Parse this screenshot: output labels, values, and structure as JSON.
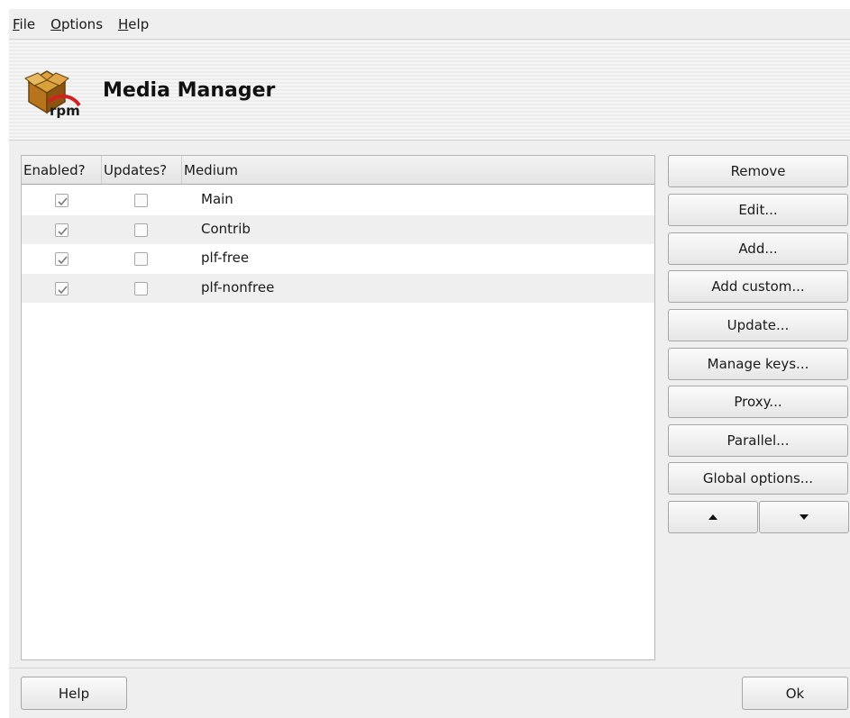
{
  "menubar": {
    "items": [
      {
        "mnemonic": "F",
        "rest": "ile"
      },
      {
        "mnemonic": "O",
        "rest": "ptions"
      },
      {
        "mnemonic": "H",
        "rest": "elp"
      }
    ]
  },
  "header": {
    "title": "Media Manager",
    "logo_text": "rpm",
    "logo_icon": "rpm-package-icon"
  },
  "list": {
    "columns": {
      "enabled": "Enabled?",
      "updates": "Updates?",
      "medium": "Medium"
    },
    "rows": [
      {
        "enabled": true,
        "updates": false,
        "medium": "Main"
      },
      {
        "enabled": true,
        "updates": false,
        "medium": "Contrib"
      },
      {
        "enabled": true,
        "updates": false,
        "medium": "plf-free"
      },
      {
        "enabled": true,
        "updates": false,
        "medium": "plf-nonfree"
      }
    ]
  },
  "buttons": {
    "remove": "Remove",
    "edit": "Edit...",
    "add": "Add...",
    "add_custom": "Add custom...",
    "update": "Update...",
    "manage_keys": "Manage keys...",
    "proxy": "Proxy...",
    "parallel": "Parallel...",
    "global_options": "Global options...",
    "move_up_icon": "arrow-up-icon",
    "move_down_icon": "arrow-down-icon",
    "help": "Help",
    "ok": "Ok"
  },
  "colors": {
    "window_bg": "#efefef",
    "list_bg": "#ffffff",
    "alt_row": "#efefef",
    "check_mark": "#7a7a7a"
  }
}
